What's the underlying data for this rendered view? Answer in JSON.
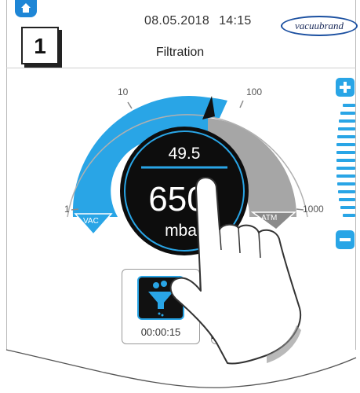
{
  "header": {
    "date": "08.05.2018",
    "time": "14:15",
    "logo_text": "vacuubrand"
  },
  "step_number": "1",
  "page_title": "Filtration",
  "gauge": {
    "scale_labels": [
      "1",
      "10",
      "100",
      "1000"
    ],
    "vac_label": "VAC",
    "atm_label": "ATM",
    "setpoint_value": "49.5",
    "pressure_value": "650",
    "pressure_unit": "mbar",
    "accent_color": "#29a5e6",
    "inactive_color": "#a6a6a6"
  },
  "side_control": {
    "plus_icon": "plus-icon",
    "minus_icon": "minus-icon"
  },
  "program": {
    "icon": "filter-funnel-icon",
    "timer": "00:00:15"
  }
}
